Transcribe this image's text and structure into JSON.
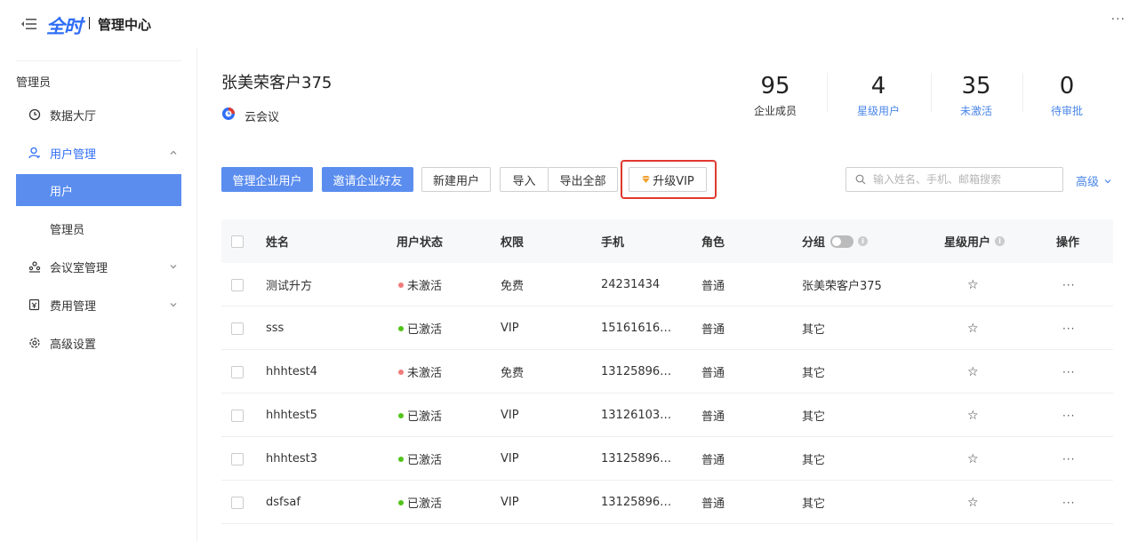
{
  "header": {
    "logo_text": "全时",
    "title": "管理中心",
    "more": "···"
  },
  "sidebar": {
    "group_label": "管理员",
    "items": [
      {
        "label": "数据大厅",
        "icon": "clock-icon"
      },
      {
        "label": "用户管理",
        "icon": "user-icon"
      },
      {
        "label": "用户"
      },
      {
        "label": "管理员"
      },
      {
        "label": "会议室管理",
        "icon": "meeting-room-icon"
      },
      {
        "label": "费用管理",
        "icon": "billing-icon"
      },
      {
        "label": "高级设置",
        "icon": "settings-icon"
      }
    ]
  },
  "company": {
    "name": "张美荣客户375",
    "product": "云会议"
  },
  "stats": [
    {
      "value": "95",
      "label": "企业成员"
    },
    {
      "value": "4",
      "label": "星级用户"
    },
    {
      "value": "35",
      "label": "未激活"
    },
    {
      "value": "0",
      "label": "待审批"
    }
  ],
  "toolbar": {
    "manage_users": "管理企业用户",
    "invite_friends": "邀请企业好友",
    "new_user": "新建用户",
    "import": "导入",
    "export_all": "导出全部",
    "upgrade_vip": "升级VIP",
    "search_placeholder": "输入姓名、手机、邮箱搜索",
    "advanced": "高级"
  },
  "table": {
    "columns": {
      "name": "姓名",
      "status": "用户状态",
      "permission": "权限",
      "phone": "手机",
      "role": "角色",
      "group": "分组",
      "star": "星级用户",
      "actions": "操作"
    },
    "rows": [
      {
        "name": "测试升方",
        "status": "未激活",
        "permission": "免费",
        "phone": "24231434",
        "role": "普通",
        "group": "张美荣客户375"
      },
      {
        "name": "sss",
        "status": "已激活",
        "permission": "VIP",
        "phone": "15161616…",
        "role": "普通",
        "group": "其它"
      },
      {
        "name": "hhhtest4",
        "status": "未激活",
        "permission": "免费",
        "phone": "13125896…",
        "role": "普通",
        "group": "其它"
      },
      {
        "name": "hhhtest5",
        "status": "已激活",
        "permission": "VIP",
        "phone": "13126103…",
        "role": "普通",
        "group": "其它"
      },
      {
        "name": "hhhtest3",
        "status": "已激活",
        "permission": "VIP",
        "phone": "13125896…",
        "role": "普通",
        "group": "其它"
      },
      {
        "name": "dsfsaf",
        "status": "已激活",
        "permission": "VIP",
        "phone": "13125896…",
        "role": "普通",
        "group": "其它"
      }
    ]
  },
  "colors": {
    "accent": "#5b8def",
    "link": "#4a86e8",
    "active_dot": "#52c41a",
    "inactive_dot": "#f07c7c",
    "highlight": "#e0392e"
  }
}
